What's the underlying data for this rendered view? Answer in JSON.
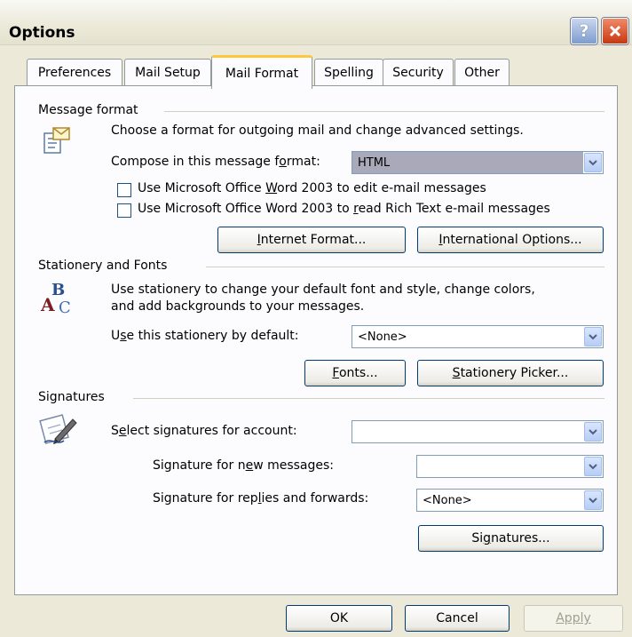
{
  "window": {
    "title": "Options"
  },
  "tabs": [
    {
      "label": "Preferences"
    },
    {
      "label": "Mail Setup"
    },
    {
      "label": "Mail Format"
    },
    {
      "label": "Spelling"
    },
    {
      "label": "Security"
    },
    {
      "label": "Other"
    }
  ],
  "message_format": {
    "group_label": "Message format",
    "description": "Choose a format for outgoing mail and change advanced settings.",
    "compose_label": "Compose in this message format:",
    "compose_value": "HTML",
    "word_edit_label": "Use Microsoft Office Word 2003 to edit e-mail messages",
    "word_edit_checked": false,
    "word_read_label": "Use Microsoft Office Word 2003 to read Rich Text e-mail messages",
    "word_read_checked": false,
    "internet_format_button": "Internet Format...",
    "international_options_button": "International Options..."
  },
  "stationery_fonts": {
    "group_label": "Stationery and Fonts",
    "description_line1": "Use stationery to change your default font and style, change colors,",
    "description_line2": "and add backgrounds to your messages.",
    "stationery_label": "Use this stationery by default:",
    "stationery_value": "<None>",
    "fonts_button": "Fonts...",
    "stationery_picker_button": "Stationery Picker..."
  },
  "signatures": {
    "group_label": "Signatures",
    "account_label": "Select signatures for account:",
    "account_value": "",
    "new_messages_label": "Signature for new messages:",
    "new_messages_value": "",
    "replies_label": "Signature for replies and forwards:",
    "replies_value": "<None>",
    "signatures_button": "Signatures..."
  },
  "footer": {
    "ok_button": "OK",
    "cancel_button": "Cancel",
    "apply_button": "Apply",
    "apply_enabled": false
  },
  "icons": {
    "message_format": "message-format-icon",
    "stationery": "stationery-fonts-icon",
    "signatures": "signature-pen-icon",
    "help": "help-icon",
    "close": "close-icon",
    "dropdown": "chevron-down-icon"
  },
  "colors": {
    "dialog_bg": "#ece9d8",
    "panel_bg": "#fcfcfe",
    "active_tab_accent": "#ffc83c",
    "close_button": "#c8380f",
    "button_border": "#003c74"
  }
}
